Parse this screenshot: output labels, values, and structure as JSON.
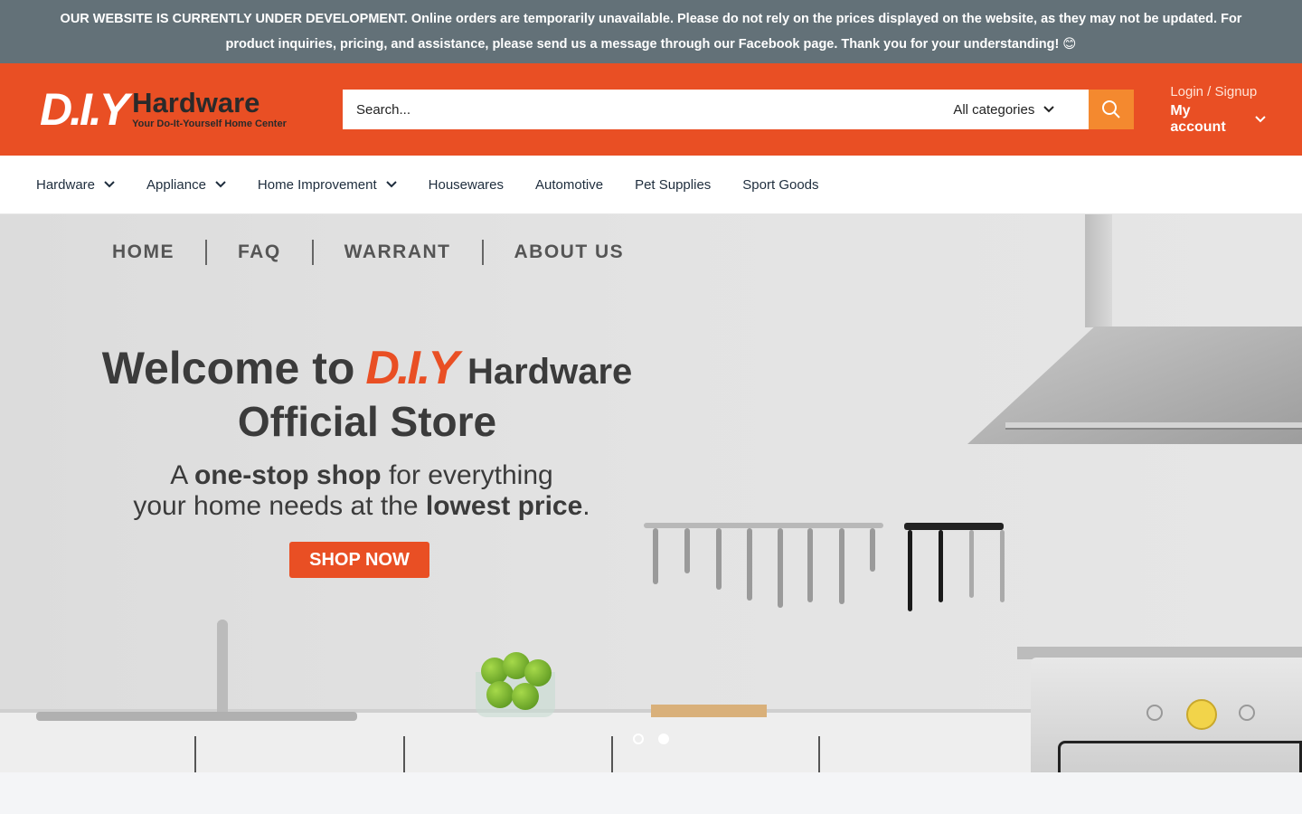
{
  "announcement": {
    "text": "OUR WEBSITE IS CURRENTLY UNDER DEVELOPMENT. Online orders are temporarily unavailable. Please do not rely on the prices displayed on the website, as they may not be updated. For product inquiries, pricing, and assistance, please send us a message through our Facebook page. Thank you for your understanding! 😊"
  },
  "header": {
    "logo_mark": "D.I.Y",
    "logo_name": "Hardware",
    "logo_tagline": "Your Do-It-Yourself Home Center",
    "search_placeholder": "Search...",
    "category_label": "All categories",
    "login_label": "Login / Signup",
    "account_label": "My account"
  },
  "nav": {
    "items": [
      {
        "label": "Hardware",
        "dropdown": true
      },
      {
        "label": "Appliance",
        "dropdown": true
      },
      {
        "label": "Home Improvement",
        "dropdown": true
      },
      {
        "label": "Housewares",
        "dropdown": false
      },
      {
        "label": "Automotive",
        "dropdown": false
      },
      {
        "label": "Pet Supplies",
        "dropdown": false
      },
      {
        "label": "Sport Goods",
        "dropdown": false
      }
    ]
  },
  "hero": {
    "top_links": [
      "HOME",
      "FAQ",
      "WARRANT",
      "ABOUT US"
    ],
    "welcome_prefix": "Welcome to",
    "brand_mark": "D.I.Y",
    "brand_name": "Hardware",
    "title_line2": "Official Store",
    "sub_a": "A ",
    "sub_bold1": "one-stop shop",
    "sub_b": " for everything",
    "sub_c": "your home needs at the ",
    "sub_bold2": "lowest price",
    "sub_d": ".",
    "cta_label": "SHOP NOW",
    "slides_total": 2,
    "active_slide": 2
  },
  "colors": {
    "brand_orange": "#e94f24",
    "search_button": "#f4892f",
    "announcement_bg": "#637178"
  }
}
